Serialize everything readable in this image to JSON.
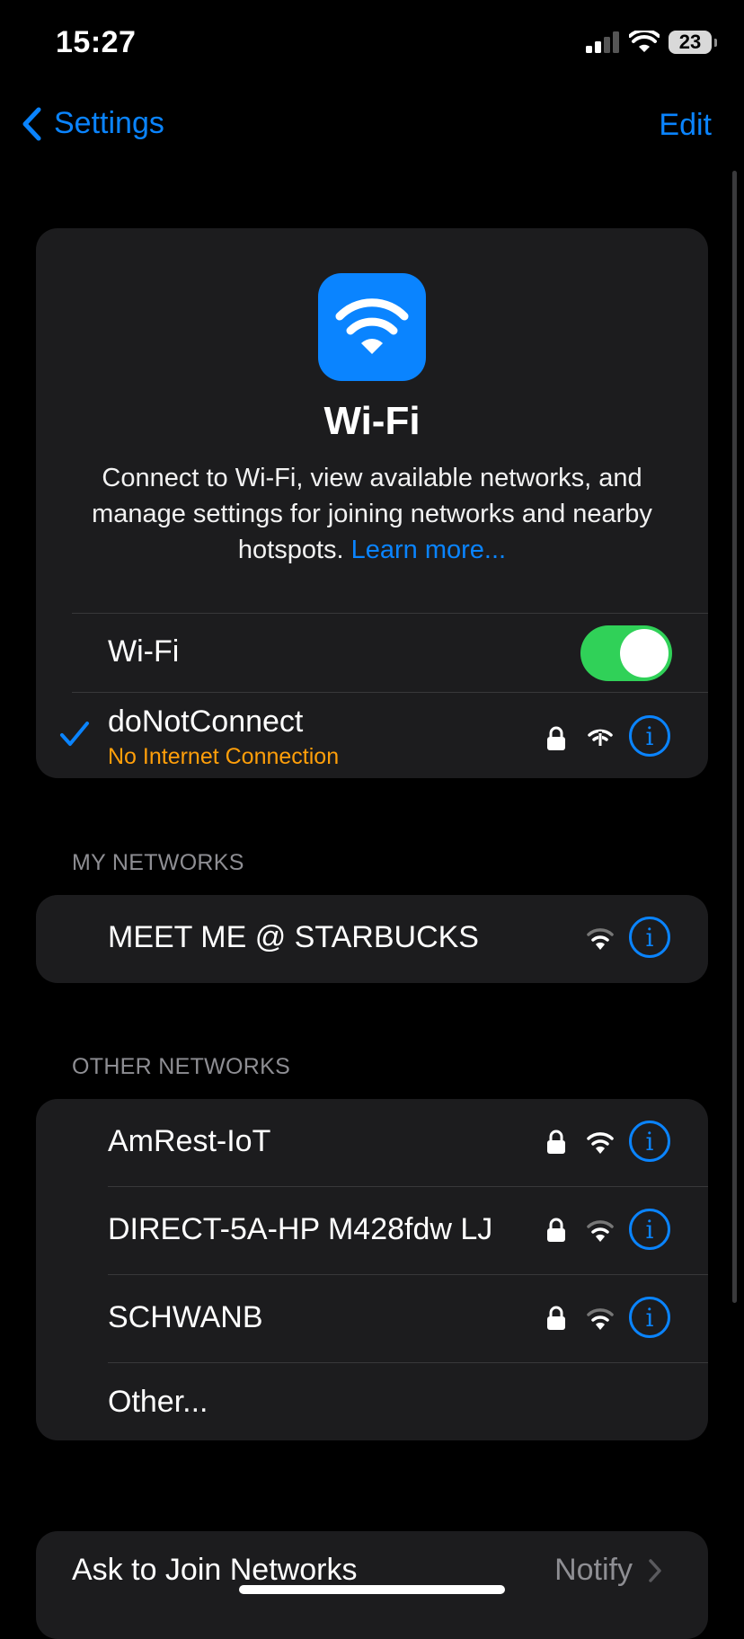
{
  "status_bar": {
    "time": "15:27",
    "battery": "23"
  },
  "nav": {
    "back_label": "Settings",
    "edit_label": "Edit"
  },
  "hero": {
    "title": "Wi-Fi",
    "description": "Connect to Wi-Fi, view available networks, and manage settings for joining networks and nearby hotspots.",
    "link": "Learn more..."
  },
  "wifi_toggle": {
    "label": "Wi-Fi",
    "state": "on"
  },
  "current_network": {
    "name": "doNotConnect",
    "status": "No Internet Connection"
  },
  "my_networks": {
    "header": "MY NETWORKS",
    "items": [
      {
        "name": "MEET ME @ STARBUCKS"
      }
    ]
  },
  "other_networks": {
    "header": "OTHER NETWORKS",
    "items": [
      {
        "name": "AmRest-IoT"
      },
      {
        "name": "DIRECT-5A-HP M428fdw LJ"
      },
      {
        "name": "SCHWANB"
      }
    ],
    "other_label": "Other..."
  },
  "ask_to_join": {
    "label": "Ask to Join Networks",
    "value": "Notify"
  },
  "colors": {
    "accent": "#0a84ff",
    "toggle_on": "#30d158",
    "warning": "#ff9f0a"
  }
}
